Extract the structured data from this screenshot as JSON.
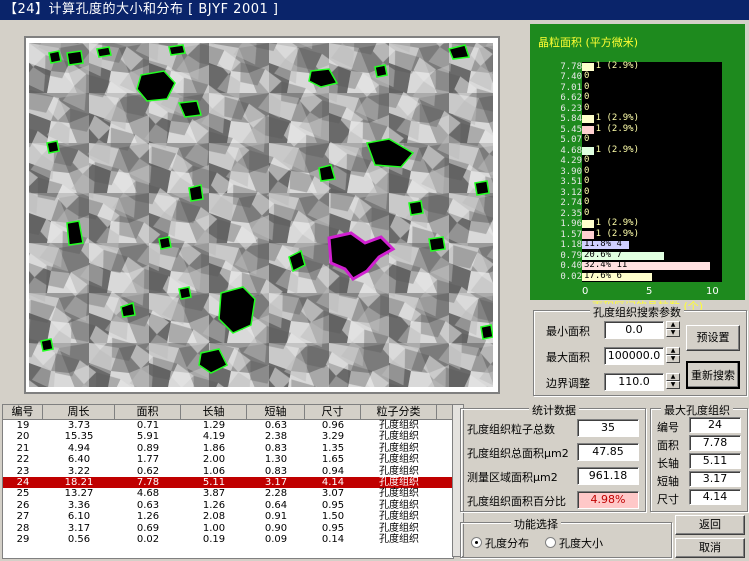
{
  "window": {
    "title": "【24】计算孔度的大小和分布 [ BJYF 2001 ]"
  },
  "histogram": {
    "title": "晶粒面积 (平方微米)",
    "xlabel": "面积区间的晶粒数 (个)",
    "xticks": [
      "0",
      "5",
      "10"
    ],
    "chart_data": {
      "type": "bar",
      "orientation": "horizontal",
      "title": "晶粒面积 (平方微米)",
      "xlabel": "面积区间的晶粒数 (个)",
      "categories": [
        "7.78",
        "7.40",
        "7.01",
        "6.62",
        "6.23",
        "5.84",
        "5.45",
        "5.07",
        "4.68",
        "4.29",
        "3.90",
        "3.51",
        "3.12",
        "2.74",
        "2.35",
        "1.96",
        "1.57",
        "1.18",
        "0.79",
        "0.40",
        "0.02"
      ],
      "values": [
        1,
        0,
        0,
        0,
        0,
        1,
        1,
        0,
        1,
        0,
        0,
        0,
        0,
        0,
        0,
        1,
        1,
        4,
        7,
        11,
        6
      ],
      "labels": [
        "1 (2.9%)",
        "0",
        "0",
        "0",
        "0",
        "1 (2.9%)",
        "1 (2.9%)",
        "0",
        "1 (2.9%)",
        "0",
        "0",
        "0",
        "0",
        "0",
        "0",
        "1 (2.9%)",
        "1 (2.9%)",
        "11.8% 4",
        "20.6% 7",
        "32.4% 11",
        "17.6% 6"
      ],
      "xlim": [
        0,
        12
      ]
    }
  },
  "params": {
    "title": "孔度组织搜索参数",
    "min_label": "最小面积",
    "min_value": "0.0",
    "max_label": "最大面积",
    "max_value": "100000.0",
    "edge_label": "边界调整",
    "edge_value": "110.0",
    "preset_btn": "预设置",
    "research_btn": "重新搜索"
  },
  "stats": {
    "title": "统计数据",
    "count_label": "孔度组织粒子总数",
    "count_value": "35",
    "total_label": "孔度组织总面积μm2",
    "total_value": "47.85",
    "area_label": "测量区域面积μm2",
    "area_value": "961.18",
    "percent_label": "孔度组织面积百分比",
    "percent_value": "4.98%"
  },
  "maxpore": {
    "title": "最大孔度组织",
    "id_label": "编号",
    "id_value": "24",
    "area_label": "面积",
    "area_value": "7.78",
    "long_label": "长轴",
    "long_value": "5.11",
    "short_label": "短轴",
    "short_value": "3.17",
    "size_label": "尺寸",
    "size_value": "4.14"
  },
  "func": {
    "title": "功能选择",
    "opt1": "孔度分布",
    "opt2": "孔度大小"
  },
  "buttons": {
    "back": "返回",
    "cancel": "取消"
  },
  "table": {
    "headers": [
      "编号",
      "周长",
      "面积",
      "长轴",
      "短轴",
      "尺寸",
      "粒子分类"
    ],
    "rows": [
      [
        "19",
        "3.73",
        "0.71",
        "1.29",
        "0.63",
        "0.96",
        "孔度组织"
      ],
      [
        "20",
        "15.35",
        "5.91",
        "4.19",
        "2.38",
        "3.29",
        "孔度组织"
      ],
      [
        "21",
        "4.94",
        "0.89",
        "1.86",
        "0.83",
        "1.35",
        "孔度组织"
      ],
      [
        "22",
        "6.40",
        "1.77",
        "2.00",
        "1.30",
        "1.65",
        "孔度组织"
      ],
      [
        "23",
        "3.22",
        "0.62",
        "1.06",
        "0.83",
        "0.94",
        "孔度组织"
      ],
      [
        "24",
        "18.21",
        "7.78",
        "5.11",
        "3.17",
        "4.14",
        "孔度组织"
      ],
      [
        "25",
        "13.27",
        "4.68",
        "3.87",
        "2.28",
        "3.07",
        "孔度组织"
      ],
      [
        "26",
        "3.36",
        "0.63",
        "1.26",
        "0.64",
        "0.95",
        "孔度组织"
      ],
      [
        "27",
        "6.10",
        "1.26",
        "2.08",
        "0.91",
        "1.50",
        "孔度组织"
      ],
      [
        "28",
        "3.17",
        "0.69",
        "1.00",
        "0.90",
        "0.95",
        "孔度组织"
      ],
      [
        "29",
        "0.56",
        "0.02",
        "0.19",
        "0.09",
        "0.14",
        "孔度组织"
      ]
    ],
    "selected_index": 5
  }
}
